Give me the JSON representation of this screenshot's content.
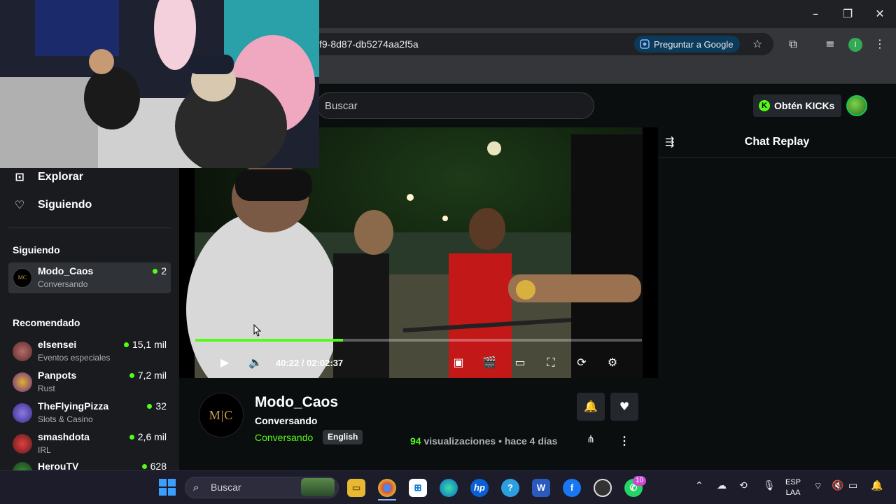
{
  "browser": {
    "url_fragment": "f9-8d87-db5274aa2f5a",
    "google_pill": "Preguntar a Google",
    "profile_initial": "I"
  },
  "header": {
    "search_placeholder": "Buscar",
    "kicks_label": "Obtén KICKs"
  },
  "sidebar": {
    "nav": [
      {
        "label": "Explorar",
        "icon": "browse-icon"
      },
      {
        "label": "Siguiendo",
        "icon": "heart-icon"
      }
    ],
    "following_title": "Siguiendo",
    "following": [
      {
        "name": "Modo_Caos",
        "category": "Conversando",
        "viewers": "2"
      }
    ],
    "recommended_title": "Recomendado",
    "recommended": [
      {
        "name": "elsensei",
        "category": "Eventos especiales",
        "viewers": "15,1 mil"
      },
      {
        "name": "Panpots",
        "category": "Rust",
        "viewers": "7,2 mil"
      },
      {
        "name": "TheFlyingPizza",
        "category": "Slots & Casino",
        "viewers": "32"
      },
      {
        "name": "smashdota",
        "category": "IRL",
        "viewers": "2,6 mil"
      },
      {
        "name": "HerouTV",
        "category": "",
        "viewers": "628"
      }
    ]
  },
  "player": {
    "current_time": "40:22",
    "separator": "/",
    "duration": "02:02:37",
    "progress": 0.33
  },
  "stream": {
    "logo_text": "M|C",
    "channel": "Modo_Caos",
    "title": "Conversando",
    "category": "Conversando",
    "language": "English",
    "views_count": "94",
    "views_label": "visualizaciones",
    "bullet": "•",
    "age": "hace 4 días"
  },
  "chat": {
    "title": "Chat Replay"
  },
  "taskbar": {
    "search_label": "Buscar",
    "input_lang_1": "ESP",
    "input_lang_2": "LAA",
    "whatsapp_badge": "10"
  },
  "colors": {
    "kick_green": "#53fc18",
    "sidebar_bg": "#191b1f",
    "page_bg": "#0b0e0f"
  }
}
